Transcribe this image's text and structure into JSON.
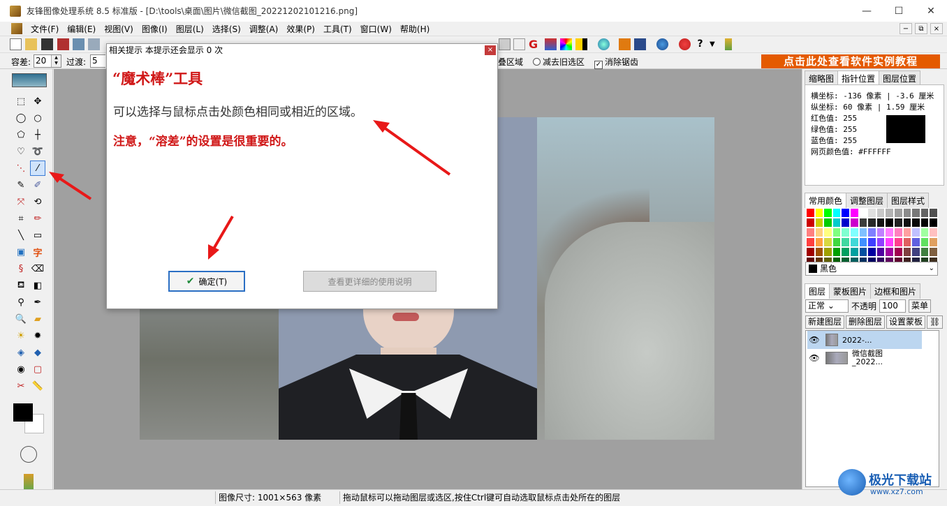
{
  "window": {
    "title": "友锋图像处理系统 8.5 标准版 - [D:\\tools\\桌面\\图片\\微信截图_20221202101216.png]",
    "minimize": "—",
    "maximize": "☐",
    "close": "✕"
  },
  "menu": {
    "items": [
      "文件(F)",
      "编辑(E)",
      "视图(V)",
      "图像(I)",
      "图层(L)",
      "选择(S)",
      "调整(A)",
      "效果(P)",
      "工具(T)",
      "窗口(W)",
      "帮助(H)"
    ],
    "mdi": [
      "−",
      "⧉",
      "×"
    ]
  },
  "options": {
    "tolerance_label": "容差:",
    "tolerance_value": "20",
    "transition_label": "过渡:",
    "transition_value": "5",
    "add_region_label": "叠区域",
    "subtract_label": "减去旧选区",
    "antialias_label": "消除锯齿",
    "banner": "点击此处查看软件实例教程"
  },
  "dialog": {
    "title": "相关提示  本提示还会显示 0 次",
    "close": "×",
    "heading": "“魔术棒”工具",
    "body": "可以选择与鼠标点击处颜色相同或相近的区域。",
    "note": "注意，“溶差”的设置是很重要的。",
    "ok_button": "确定(T)",
    "more_button": "查看更详细的使用说明"
  },
  "right_panel": {
    "top_tabs": [
      "缩略图",
      "指针位置",
      "图层位置"
    ],
    "info": {
      "x_line": "横坐标: -136 像素 | -3.6 厘米",
      "y_line": "纵坐标: 60 像素  | 1.59 厘米",
      "red": "红色值: 255",
      "green": "绿色值: 255",
      "blue": "蓝色值: 255",
      "web": "网页颜色值: #FFFFFF"
    },
    "color_tabs": [
      "常用颜色",
      "调整图层",
      "图层样式"
    ],
    "selected_color": "黑色",
    "layer_tabs": [
      "图层",
      "蒙板图片",
      "边框和图片"
    ],
    "blend_mode": "正常",
    "opacity_label": "不透明",
    "opacity_value": "100",
    "menu_button": "菜单",
    "layer_buttons": [
      "新建图层",
      "删除图层",
      "设置蒙板"
    ],
    "layers": [
      {
        "name": "2022-..."
      },
      {
        "name": "微信截图",
        "name2": "_2022..."
      }
    ]
  },
  "statusbar": {
    "image_size": "图像尺寸: 1001×563 像素",
    "hint": "拖动鼠标可以拖动图层或选区,按住Ctrl键可自动选取鼠标点击处所在的图层"
  },
  "watermark": {
    "text": "极光下载站",
    "url": "www.xz7.com"
  },
  "palette_colors": [
    "#ff0000",
    "#ffff00",
    "#00ff00",
    "#00ffff",
    "#0000ff",
    "#ff00ff",
    "#ffffff",
    "#e0e0e0",
    "#c8c8c8",
    "#b4b4b4",
    "#a0a0a0",
    "#8c8c8c",
    "#787878",
    "#646464",
    "#505050",
    "#cc0000",
    "#cccc00",
    "#00cc00",
    "#00cccc",
    "#0000cc",
    "#cc00cc",
    "#3c3c3c",
    "#282828",
    "#141414",
    "#000000",
    "#202020",
    "#101010",
    "#080808",
    "#040404",
    "#000000",
    "#ff8080",
    "#ffd080",
    "#ffff80",
    "#80ff80",
    "#80ffd0",
    "#80ffff",
    "#80c0ff",
    "#8080ff",
    "#c080ff",
    "#ff80ff",
    "#ff80c0",
    "#ffa0a0",
    "#c0c0ff",
    "#a0ffa0",
    "#ffc0c0",
    "#ff4040",
    "#ffa040",
    "#d8d840",
    "#40d840",
    "#40d8a0",
    "#40d8d8",
    "#4090ff",
    "#4040ff",
    "#9040ff",
    "#ff40ff",
    "#ff4090",
    "#e06060",
    "#6060e0",
    "#60e060",
    "#e0a060",
    "#a00000",
    "#a05000",
    "#a0a000",
    "#00a000",
    "#00a060",
    "#00a0a0",
    "#0050a0",
    "#0000a0",
    "#5000a0",
    "#a000a0",
    "#a00050",
    "#804040",
    "#404080",
    "#408040",
    "#806040",
    "#600000",
    "#603000",
    "#606000",
    "#006000",
    "#006030",
    "#006060",
    "#003060",
    "#000060",
    "#300060",
    "#600060",
    "#600030",
    "#402020",
    "#202040",
    "#204020",
    "#403020"
  ]
}
